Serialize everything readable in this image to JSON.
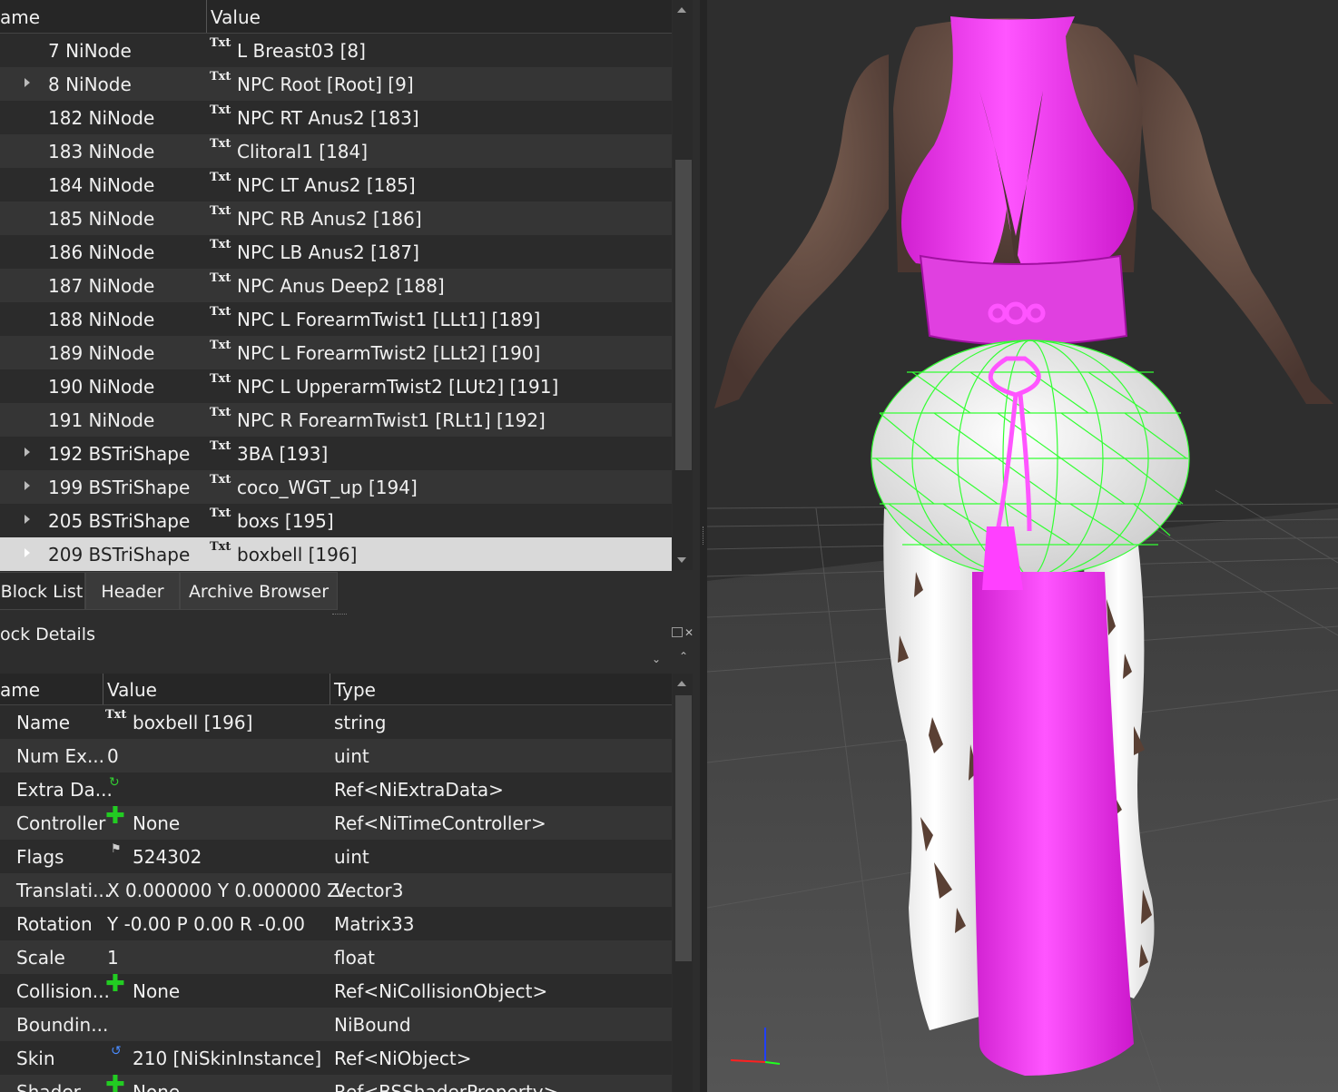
{
  "block_list": {
    "col_name": "ame",
    "col_value": "Value",
    "rows": [
      {
        "name": "7 NiNode",
        "value": "L Breast03 [8]",
        "expand": false
      },
      {
        "name": "8 NiNode",
        "value": "NPC Root [Root] [9]",
        "expand": true
      },
      {
        "name": "182 NiNode",
        "value": "NPC RT Anus2 [183]",
        "expand": false
      },
      {
        "name": "183 NiNode",
        "value": "Clitoral1 [184]",
        "expand": false
      },
      {
        "name": "184 NiNode",
        "value": "NPC LT Anus2 [185]",
        "expand": false
      },
      {
        "name": "185 NiNode",
        "value": "NPC RB Anus2 [186]",
        "expand": false
      },
      {
        "name": "186 NiNode",
        "value": "NPC LB Anus2 [187]",
        "expand": false
      },
      {
        "name": "187 NiNode",
        "value": "NPC Anus Deep2 [188]",
        "expand": false
      },
      {
        "name": "188 NiNode",
        "value": "NPC L ForearmTwist1 [LLt1] [189]",
        "expand": false
      },
      {
        "name": "189 NiNode",
        "value": "NPC L ForearmTwist2 [LLt2] [190]",
        "expand": false
      },
      {
        "name": "190 NiNode",
        "value": "NPC L UpperarmTwist2 [LUt2] [191]",
        "expand": false
      },
      {
        "name": "191 NiNode",
        "value": "NPC R ForearmTwist1 [RLt1] [192]",
        "expand": false
      },
      {
        "name": "192 BSTriShape",
        "value": "3BA [193]",
        "expand": true
      },
      {
        "name": "199 BSTriShape",
        "value": "coco_WGT_up [194]",
        "expand": true
      },
      {
        "name": "205 BSTriShape",
        "value": "boxs [195]",
        "expand": true
      },
      {
        "name": "209 BSTriShape",
        "value": "boxbell [196]",
        "expand": true,
        "selected": true
      }
    ],
    "txt_icon": "Txt"
  },
  "tabs": [
    "Block List",
    "Header",
    "Archive Browser"
  ],
  "details": {
    "title": "ock Details",
    "col_name": "ame",
    "col_value": "Value",
    "col_type": "Type",
    "rows": [
      {
        "name": "Name",
        "icon": "txt-icon",
        "value": "boxbell [196]",
        "type": "string"
      },
      {
        "name": "Num Ex...",
        "icon": "",
        "value": "0",
        "type": "uint"
      },
      {
        "name": "Extra Da...",
        "icon": "refresh-icon",
        "value": "",
        "type": "Ref<NiExtraData>"
      },
      {
        "name": "Controller",
        "icon": "plus-icon",
        "value": "None",
        "type": "Ref<NiTimeController>"
      },
      {
        "name": "Flags",
        "icon": "flag-icon",
        "value": "524302",
        "type": "uint"
      },
      {
        "name": "Translati...",
        "icon": "",
        "value": "X 0.000000 Y 0.000000 Z...",
        "type": "Vector3"
      },
      {
        "name": "Rotation",
        "icon": "",
        "value": "Y -0.00 P 0.00 R -0.00",
        "type": "Matrix33"
      },
      {
        "name": "Scale",
        "icon": "",
        "value": "1",
        "type": "float"
      },
      {
        "name": "Collision...",
        "icon": "plus-icon",
        "value": "None",
        "type": "Ref<NiCollisionObject>"
      },
      {
        "name": "Boundin...",
        "icon": "",
        "value": "",
        "type": "NiBound"
      },
      {
        "name": "Skin",
        "icon": "link-icon",
        "value": "210 [NiSkinInstance]",
        "type": "Ref<NiObject>"
      },
      {
        "name": "Shader...",
        "icon": "plus-icon",
        "value": "None",
        "type": "Ref<BSShaderProperty>"
      }
    ]
  },
  "colors": {
    "mesh_pink": "#ff2bff",
    "wire_green": "#33ff33",
    "skin": "#6a5044",
    "selection": "#d9d9d9"
  }
}
